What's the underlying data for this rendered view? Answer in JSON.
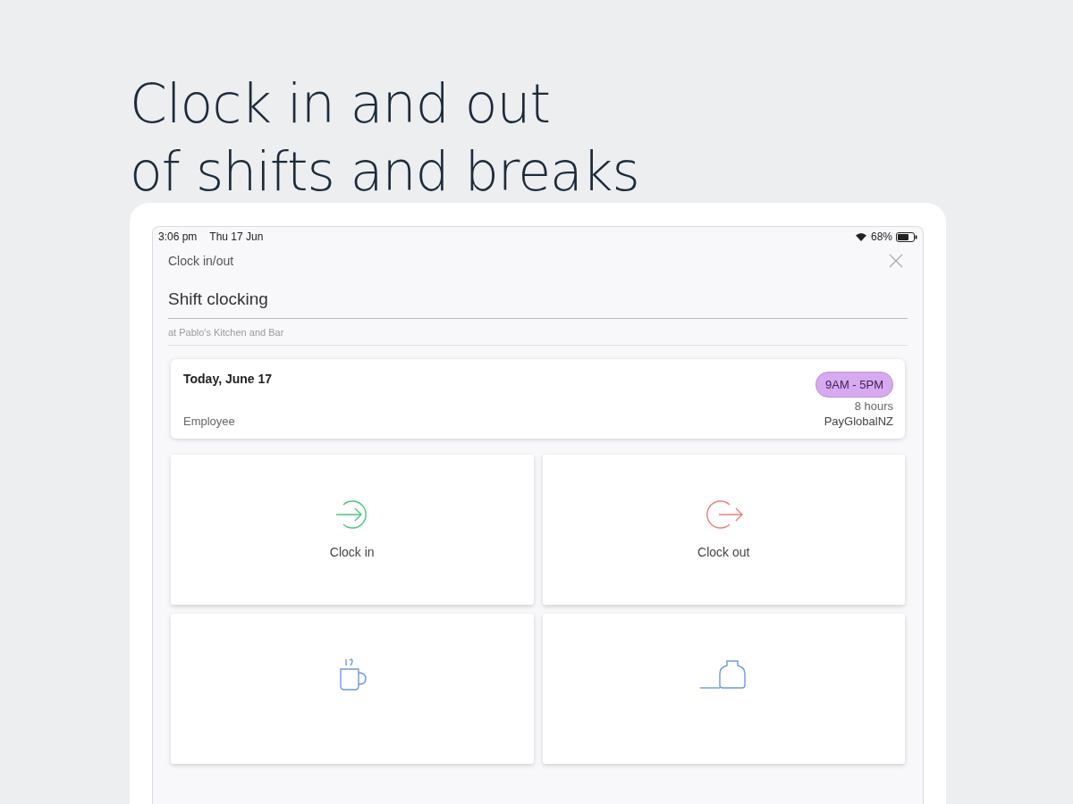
{
  "headline": [
    "Clock in and out",
    "of shifts and breaks"
  ],
  "status_bar": {
    "time": "3:06 pm",
    "date": "Thu 17 Jun",
    "battery": "68%"
  },
  "header": {
    "title": "Clock in/out"
  },
  "title": "Shift clocking",
  "subtitle": "at Pablo's Kitchen and Bar",
  "shift_card": {
    "date": "Today, June 17",
    "time_range": "9AM - 5PM",
    "duration": "8 hours",
    "role": "Employee",
    "company": "PayGlobalNZ"
  },
  "actions": [
    {
      "kind": "clock-in",
      "label": "Clock in"
    },
    {
      "kind": "clock-out",
      "label": "Clock out"
    },
    {
      "kind": "break-start"
    },
    {
      "kind": "break-end"
    }
  ]
}
